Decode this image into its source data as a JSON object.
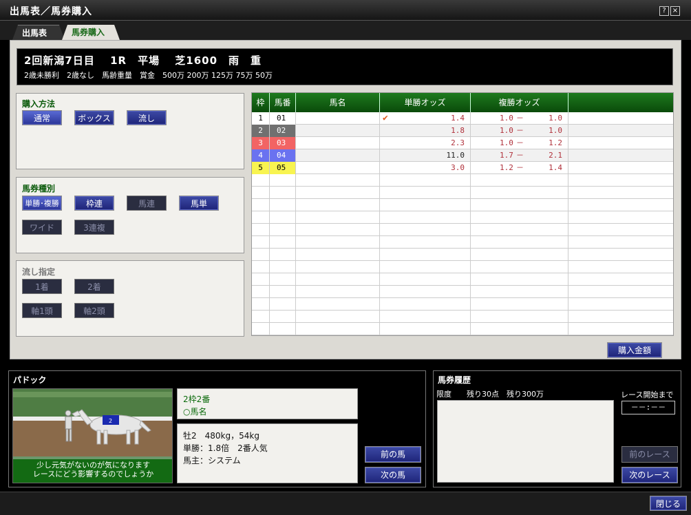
{
  "window": {
    "title": "出馬表／馬券購入",
    "help": "?",
    "close": "×"
  },
  "tabs": [
    {
      "label": "出馬表"
    },
    {
      "label": "馬券購入"
    }
  ],
  "race": {
    "title": "2回新潟7日目　 1R　平場　 芝1600　雨　重",
    "info": "2歳未勝利　2歳なし　馬齢重量　賞金　500万 200万 125万 75万 50万"
  },
  "purchase_method": {
    "label": "購入方法",
    "buttons": [
      "通常",
      "ボックス",
      "流し"
    ]
  },
  "ticket_type": {
    "label": "馬券種別",
    "buttons": [
      "単勝･複勝",
      "枠連",
      "馬連",
      "馬単",
      "ワイド",
      "3連複"
    ]
  },
  "nagashi": {
    "label": "流し指定",
    "buttons": [
      "1着",
      "2着",
      "軸1頭",
      "軸2頭"
    ]
  },
  "table": {
    "headers": [
      "枠",
      "馬番",
      "馬名",
      "単勝オッズ",
      "複勝オッズ",
      ""
    ],
    "rows": [
      {
        "waku": "1",
        "umaban": "01",
        "name": "",
        "win": "1.4",
        "place_lo": "1.0",
        "place_hi": "1.0",
        "checked": true,
        "color": "#ffffff",
        "text": "#000000"
      },
      {
        "waku": "2",
        "umaban": "02",
        "name": "",
        "win": "1.8",
        "place_lo": "1.0",
        "place_hi": "1.0",
        "checked": false,
        "color": "#707070",
        "text": "#ffffff"
      },
      {
        "waku": "3",
        "umaban": "03",
        "name": "",
        "win": "2.3",
        "place_lo": "1.0",
        "place_hi": "1.2",
        "checked": false,
        "color": "#f26464",
        "text": "#ffffff"
      },
      {
        "waku": "4",
        "umaban": "04",
        "name": "",
        "win": "11.0",
        "place_lo": "1.7",
        "place_hi": "2.1",
        "checked": false,
        "color": "#6a72f0",
        "text": "#ffffff"
      },
      {
        "waku": "5",
        "umaban": "05",
        "name": "",
        "win": "3.0",
        "place_lo": "1.2",
        "place_hi": "1.4",
        "checked": false,
        "color": "#f8f450",
        "text": "#000000"
      }
    ],
    "dash": "－"
  },
  "buy_amount_label": "購入金額",
  "paddock": {
    "label": "パドック",
    "horse_heading": "2枠2番",
    "horse_name_label": "○馬名",
    "stats": [
      "牡2　480kg，54kg",
      "単勝：1.8倍　2番人気",
      "馬主：システム"
    ],
    "comment": "少し元気がないのが気になります\nレースにどう影響するのでしょうか",
    "saddle_number": "2",
    "prev": "前の馬",
    "next": "次の馬"
  },
  "history": {
    "label": "馬券履歴",
    "limit": "限度　　残り30点　残り300万",
    "countdown_label": "レース開始まで",
    "countdown": "－－:－－",
    "prev": "前のレース",
    "next": "次のレース"
  },
  "close_label": "閉じる"
}
